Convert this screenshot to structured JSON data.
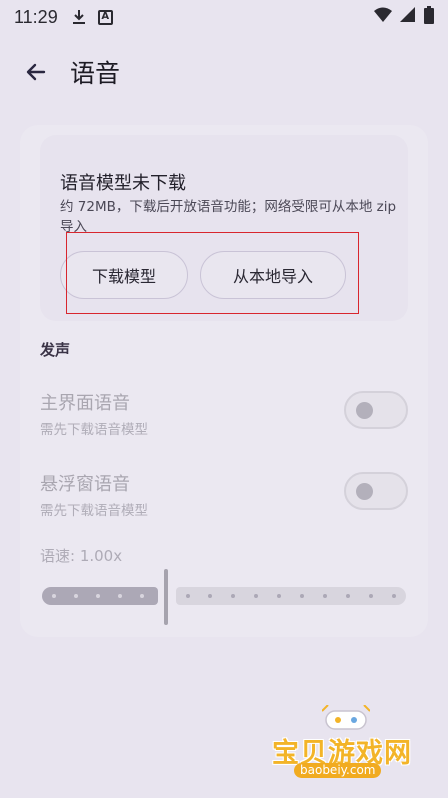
{
  "status_bar": {
    "time": "11:29",
    "icons": [
      "download-icon",
      "a-badge-icon",
      "wifi-icon",
      "signal-icon",
      "battery-icon"
    ],
    "a_badge": "A"
  },
  "app_bar": {
    "title": "语音",
    "back_icon": "arrow-left-icon"
  },
  "notice": {
    "title": "语音模型未下载",
    "description": "约 72MB，下载后开放语音功能；网络受限可从本地 zip 导入",
    "download_button": "下载模型",
    "import_button": "从本地导入"
  },
  "section": {
    "title": "发声"
  },
  "settings": [
    {
      "label": "主界面语音",
      "sub": "需先下载语音模型",
      "enabled": false,
      "checked": false
    },
    {
      "label": "悬浮窗语音",
      "sub": "需先下载语音模型",
      "enabled": false,
      "checked": false
    }
  ],
  "speed": {
    "label": "语速: 1.00x",
    "value": 1.0
  },
  "watermark": {
    "text": "宝贝游戏网",
    "url": "baobeiy.com"
  },
  "colors": {
    "background": "#e8e4ef",
    "card": "#ebe8f1",
    "highlight": "#d8262e",
    "watermark": "#f3b428"
  }
}
